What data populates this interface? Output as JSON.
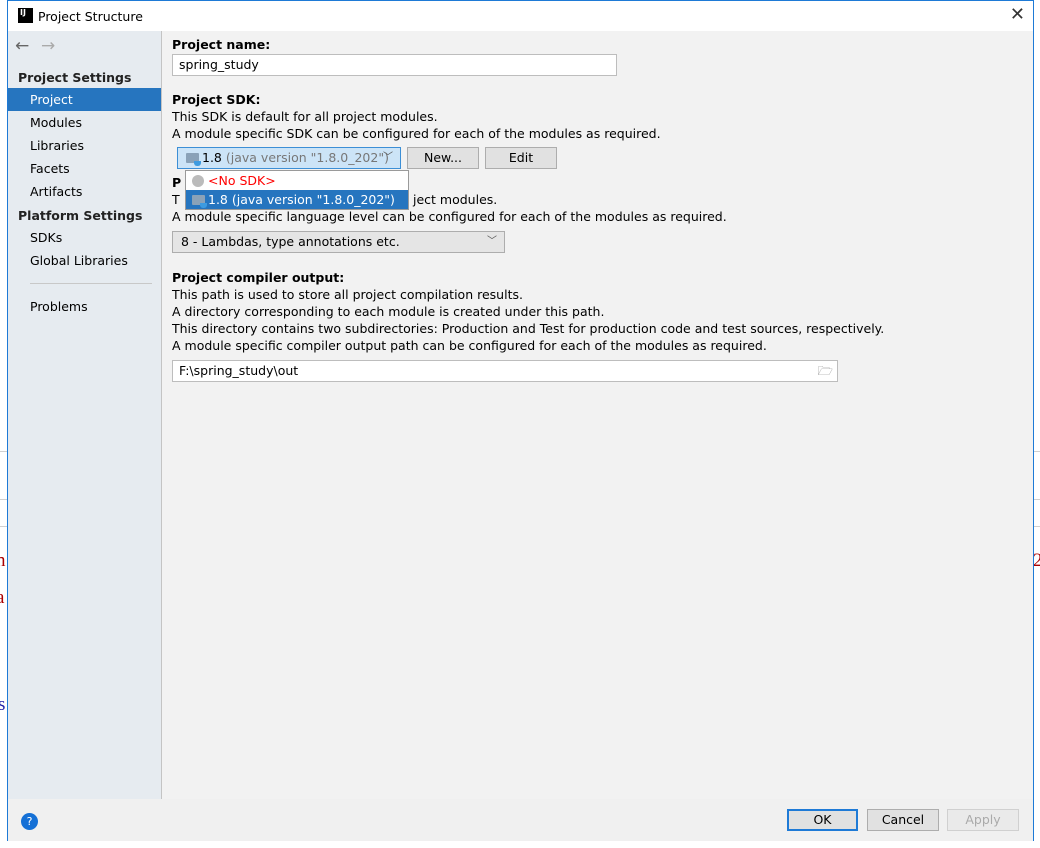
{
  "background": {
    "fragments": [
      "n",
      "a",
      "s",
      "2"
    ]
  },
  "dialog": {
    "title": "Project Structure"
  },
  "sidebar": {
    "back_icon": "arrow-left-icon",
    "forward_icon": "arrow-right-icon",
    "project_settings_header": "Project Settings",
    "project_items": [
      {
        "label": "Project",
        "selected": true
      },
      {
        "label": "Modules"
      },
      {
        "label": "Libraries"
      },
      {
        "label": "Facets"
      },
      {
        "label": "Artifacts"
      }
    ],
    "platform_settings_header": "Platform Settings",
    "platform_items": [
      {
        "label": "SDKs"
      },
      {
        "label": "Global Libraries"
      }
    ],
    "problems": "Problems"
  },
  "main": {
    "project_name": {
      "label": "Project name:",
      "value": "spring_study"
    },
    "sdk": {
      "label": "Project SDK:",
      "desc1": "This SDK is default for all project modules.",
      "desc2": "A module specific SDK can be configured for each of the modules as required.",
      "selected_version": "1.8",
      "selected_detail": "(java version \"1.8.0_202\")",
      "new_button": "New...",
      "edit_button": "Edit",
      "options": [
        {
          "label": "<No SDK>",
          "color": "#ff0000"
        },
        {
          "label": "1.8 (java version \"1.8.0_202\")",
          "selected": true
        }
      ]
    },
    "language_level": {
      "label_visible": "P",
      "desc1_start": "T",
      "desc1_end": "ject modules.",
      "desc2": "A module specific language level can be configured for each of the modules as required.",
      "value": "8 - Lambdas, type annotations etc."
    },
    "compiler_output": {
      "label": "Project compiler output:",
      "desc1": "This path is used to store all project compilation results.",
      "desc2": "A directory corresponding to each module is created under this path.",
      "desc3": "This directory contains two subdirectories: Production and Test for production code and test sources, respectively.",
      "desc4": "A module specific compiler output path can be configured for each of the modules as required.",
      "value": "F:\\spring_study\\out"
    }
  },
  "footer": {
    "help": "?",
    "ok": "OK",
    "cancel": "Cancel",
    "apply": "Apply"
  },
  "colors": {
    "accent": "#2675bf",
    "border": "#1e7ad6"
  }
}
